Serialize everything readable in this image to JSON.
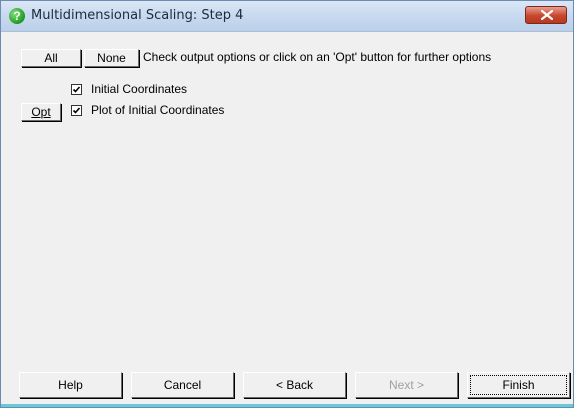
{
  "window": {
    "title": "Multidimensional Scaling: Step 4"
  },
  "toolbar": {
    "all_label": "All",
    "none_label": "None",
    "instruction": "Check output options or click on an 'Opt' button for further options"
  },
  "options": [
    {
      "label": "Initial Coordinates",
      "checked": true,
      "has_opt": false
    },
    {
      "label": "Plot of Initial Coordinates",
      "checked": true,
      "has_opt": true,
      "opt_label": "Opt"
    }
  ],
  "buttons": {
    "help": "Help",
    "cancel": "Cancel",
    "back": "< Back",
    "next": "Next >",
    "finish": "Finish"
  },
  "colors": {
    "title_bar": "#c9daf0",
    "close_button": "#c8462c",
    "dialog_bg": "#f0f0f0"
  },
  "icons": {
    "title_icon": "help-question-icon",
    "close": "close-icon",
    "check": "checkmark-icon"
  }
}
